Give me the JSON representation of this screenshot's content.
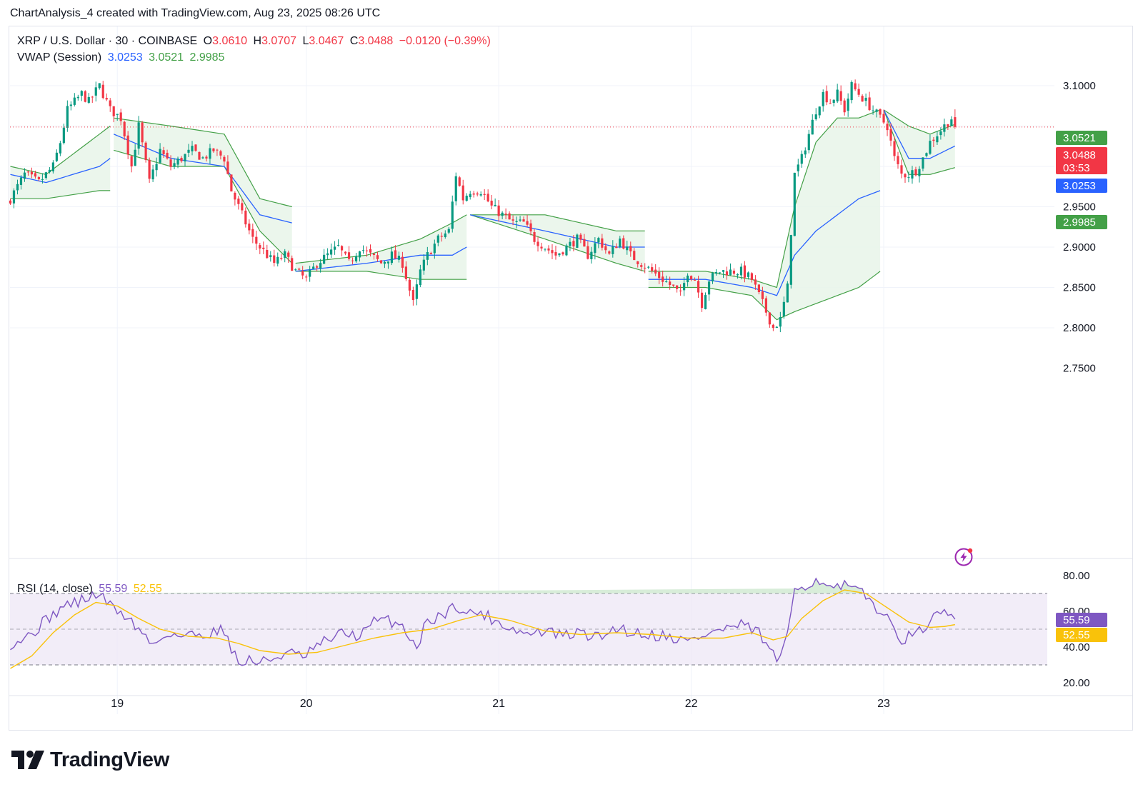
{
  "header": {
    "text": "ChartAnalysis_4 created with TradingView.com, Aug 23, 2025 08:26 UTC"
  },
  "legend": {
    "symbol": "XRP / U.S. Dollar · 30 · COINBASE",
    "o_label": "O",
    "o_value": "3.0610",
    "h_label": "H",
    "h_value": "3.0707",
    "l_label": "L",
    "l_value": "3.0467",
    "c_label": "C",
    "c_value": "3.0488",
    "change": "−0.0120 (−0.39%)",
    "vwap_label": "VWAP (Session)",
    "vwap_mid": "3.0253",
    "vwap_upper": "3.0521",
    "vwap_lower": "2.9985",
    "rsi_label": "RSI (14, close)",
    "rsi_value": "55.59",
    "rsi_ma": "52.55"
  },
  "colors": {
    "up": "#089981",
    "down": "#f23645",
    "vwap": "#2962ff",
    "band": "#43a047",
    "band_fill": "#e8f5e9",
    "rsi": "#7e57c2",
    "rsi_ma": "#f9c20a",
    "rsi_band": "#ede7f6"
  },
  "price_labels": [
    {
      "text": "3.0521",
      "color": "#43a047"
    },
    {
      "text": "3.0488",
      "sub": "03:53",
      "color": "#f23645"
    },
    {
      "text": "3.0253",
      "color": "#2962ff"
    },
    {
      "text": "2.9985",
      "color": "#43a047"
    }
  ],
  "rsi_labels": [
    {
      "text": "55.59",
      "color": "#7e57c2"
    },
    {
      "text": "52.55",
      "color": "#f9c20a"
    }
  ],
  "footer": {
    "brand": "TradingView"
  },
  "chart_data": {
    "type": "candlestick",
    "price_axis": {
      "ticks": [
        "3.1000",
        "2.9500",
        "2.9000",
        "2.8500",
        "2.8000",
        "2.7500"
      ],
      "range": [
        2.75,
        3.122
      ]
    },
    "time_axis": {
      "ticks": [
        "19",
        "20",
        "21",
        "22",
        "23"
      ]
    },
    "rsi_axis": {
      "ticks": [
        "80.00",
        "60.00",
        "40.00",
        "20.00"
      ],
      "range": [
        20,
        82
      ],
      "bands": [
        30,
        70
      ],
      "mid": 50
    },
    "anchors": [
      [
        0,
        2.96
      ],
      [
        4,
        2.99
      ],
      [
        8,
        2.98
      ],
      [
        12,
        3.0
      ],
      [
        14,
        3.03
      ],
      [
        16,
        3.07
      ],
      [
        20,
        3.09
      ],
      [
        22,
        3.08
      ],
      [
        25,
        3.1
      ],
      [
        28,
        3.07
      ],
      [
        31,
        3.06
      ],
      [
        34,
        3.0
      ],
      [
        36,
        3.05
      ],
      [
        39,
        2.98
      ],
      [
        42,
        3.02
      ],
      [
        45,
        3.0
      ],
      [
        48,
        3.01
      ],
      [
        51,
        3.02
      ],
      [
        54,
        3.01
      ],
      [
        57,
        3.02
      ],
      [
        60,
        3.01
      ],
      [
        62,
        2.97
      ],
      [
        64,
        2.95
      ],
      [
        66,
        2.93
      ],
      [
        68,
        2.91
      ],
      [
        70,
        2.9
      ],
      [
        72,
        2.89
      ],
      [
        74,
        2.88
      ],
      [
        77,
        2.89
      ],
      [
        80,
        2.87
      ],
      [
        83,
        2.86
      ],
      [
        86,
        2.88
      ],
      [
        89,
        2.89
      ],
      [
        92,
        2.9
      ],
      [
        95,
        2.88
      ],
      [
        98,
        2.9
      ],
      [
        101,
        2.89
      ],
      [
        104,
        2.88
      ],
      [
        107,
        2.89
      ],
      [
        110,
        2.88
      ],
      [
        113,
        2.83
      ],
      [
        115,
        2.87
      ],
      [
        117,
        2.89
      ],
      [
        120,
        2.91
      ],
      [
        123,
        2.92
      ],
      [
        125,
        2.99
      ],
      [
        127,
        2.96
      ],
      [
        129,
        2.97
      ],
      [
        132,
        2.97
      ],
      [
        135,
        2.95
      ],
      [
        138,
        2.94
      ],
      [
        141,
        2.93
      ],
      [
        144,
        2.93
      ],
      [
        147,
        2.91
      ],
      [
        150,
        2.9
      ],
      [
        153,
        2.89
      ],
      [
        156,
        2.9
      ],
      [
        159,
        2.91
      ],
      [
        162,
        2.89
      ],
      [
        165,
        2.91
      ],
      [
        168,
        2.89
      ],
      [
        171,
        2.91
      ],
      [
        174,
        2.89
      ],
      [
        177,
        2.88
      ],
      [
        180,
        2.87
      ],
      [
        183,
        2.86
      ],
      [
        186,
        2.85
      ],
      [
        188,
        2.84
      ],
      [
        190,
        2.87
      ],
      [
        192,
        2.86
      ],
      [
        194,
        2.83
      ],
      [
        196,
        2.86
      ],
      [
        199,
        2.87
      ],
      [
        202,
        2.87
      ],
      [
        205,
        2.87
      ],
      [
        208,
        2.86
      ],
      [
        210,
        2.84
      ],
      [
        212,
        2.82
      ],
      [
        214,
        2.8
      ],
      [
        216,
        2.81
      ],
      [
        218,
        2.85
      ],
      [
        220,
        2.99
      ],
      [
        222,
        3.01
      ],
      [
        224,
        3.04
      ],
      [
        226,
        3.07
      ],
      [
        228,
        3.09
      ],
      [
        230,
        3.08
      ],
      [
        232,
        3.09
      ],
      [
        234,
        3.07
      ],
      [
        236,
        3.1
      ],
      [
        238,
        3.09
      ],
      [
        240,
        3.08
      ],
      [
        242,
        3.07
      ],
      [
        244,
        3.06
      ],
      [
        246,
        3.05
      ],
      [
        248,
        3.01
      ],
      [
        250,
        2.99
      ],
      [
        252,
        2.99
      ],
      [
        254,
        2.995
      ],
      [
        256,
        3.01
      ],
      [
        258,
        3.03
      ],
      [
        260,
        3.04
      ],
      [
        262,
        3.05
      ],
      [
        264,
        3.06
      ],
      [
        265,
        3.0488
      ]
    ],
    "vwap_sessions": [
      {
        "upper": [
          [
            0,
            3.0
          ],
          [
            10,
            2.99
          ],
          [
            25,
            3.04
          ],
          [
            28,
            3.05
          ]
        ],
        "vwap": [
          [
            0,
            2.99
          ],
          [
            10,
            2.98
          ],
          [
            25,
            3.0
          ],
          [
            28,
            3.01
          ]
        ],
        "lower": [
          [
            0,
            2.96
          ],
          [
            10,
            2.96
          ],
          [
            25,
            2.97
          ],
          [
            28,
            2.97
          ]
        ]
      },
      {
        "upper": [
          [
            29,
            3.06
          ],
          [
            45,
            3.05
          ],
          [
            60,
            3.04
          ],
          [
            70,
            2.96
          ],
          [
            79,
            2.95
          ]
        ],
        "vwap": [
          [
            29,
            3.04
          ],
          [
            45,
            3.01
          ],
          [
            60,
            3.0
          ],
          [
            70,
            2.94
          ],
          [
            79,
            2.93
          ]
        ],
        "lower": [
          [
            29,
            3.02
          ],
          [
            45,
            3.0
          ],
          [
            60,
            3.0
          ],
          [
            70,
            2.92
          ],
          [
            79,
            2.88
          ]
        ]
      },
      {
        "upper": [
          [
            80,
            2.88
          ],
          [
            100,
            2.89
          ],
          [
            115,
            2.91
          ],
          [
            124,
            2.93
          ],
          [
            128,
            2.94
          ]
        ],
        "vwap": [
          [
            80,
            2.87
          ],
          [
            100,
            2.88
          ],
          [
            115,
            2.89
          ],
          [
            124,
            2.89
          ],
          [
            128,
            2.9
          ]
        ],
        "lower": [
          [
            80,
            2.87
          ],
          [
            100,
            2.87
          ],
          [
            115,
            2.86
          ],
          [
            128,
            2.86
          ]
        ]
      },
      {
        "upper": [
          [
            129,
            2.94
          ],
          [
            150,
            2.94
          ],
          [
            170,
            2.92
          ],
          [
            178,
            2.92
          ]
        ],
        "vwap": [
          [
            129,
            2.94
          ],
          [
            150,
            2.92
          ],
          [
            170,
            2.9
          ],
          [
            178,
            2.9
          ]
        ],
        "lower": [
          [
            129,
            2.94
          ],
          [
            150,
            2.91
          ],
          [
            170,
            2.88
          ],
          [
            178,
            2.87
          ]
        ]
      },
      {
        "upper": [
          [
            179,
            2.87
          ],
          [
            195,
            2.87
          ],
          [
            208,
            2.86
          ],
          [
            215,
            2.85
          ],
          [
            220,
            2.95
          ],
          [
            226,
            3.03
          ],
          [
            232,
            3.06
          ],
          [
            238,
            3.06
          ],
          [
            244,
            3.07
          ]
        ],
        "vwap": [
          [
            179,
            2.86
          ],
          [
            195,
            2.86
          ],
          [
            208,
            2.85
          ],
          [
            215,
            2.84
          ],
          [
            220,
            2.89
          ],
          [
            226,
            2.92
          ],
          [
            232,
            2.94
          ],
          [
            238,
            2.96
          ],
          [
            244,
            2.97
          ]
        ],
        "lower": [
          [
            179,
            2.85
          ],
          [
            195,
            2.85
          ],
          [
            208,
            2.84
          ],
          [
            215,
            2.81
          ],
          [
            220,
            2.82
          ],
          [
            226,
            2.83
          ],
          [
            232,
            2.84
          ],
          [
            238,
            2.85
          ],
          [
            244,
            2.87
          ]
        ]
      },
      {
        "upper": [
          [
            245,
            3.07
          ],
          [
            252,
            3.05
          ],
          [
            258,
            3.04
          ],
          [
            265,
            3.0521
          ]
        ],
        "vwap": [
          [
            245,
            3.07
          ],
          [
            252,
            3.01
          ],
          [
            258,
            3.01
          ],
          [
            265,
            3.0253
          ]
        ],
        "lower": [
          [
            245,
            3.07
          ],
          [
            252,
            2.99
          ],
          [
            258,
            2.99
          ],
          [
            265,
            2.9985
          ]
        ]
      }
    ],
    "rsi_anchors": [
      [
        0,
        42
      ],
      [
        5,
        46
      ],
      [
        10,
        55
      ],
      [
        15,
        63
      ],
      [
        20,
        66
      ],
      [
        25,
        70
      ],
      [
        28,
        63
      ],
      [
        32,
        58
      ],
      [
        36,
        50
      ],
      [
        40,
        41
      ],
      [
        44,
        48
      ],
      [
        48,
        46
      ],
      [
        52,
        47
      ],
      [
        56,
        48
      ],
      [
        60,
        50
      ],
      [
        62,
        40
      ],
      [
        64,
        30
      ],
      [
        67,
        33
      ],
      [
        70,
        31
      ],
      [
        74,
        34
      ],
      [
        78,
        37
      ],
      [
        82,
        34
      ],
      [
        86,
        40
      ],
      [
        90,
        45
      ],
      [
        94,
        48
      ],
      [
        98,
        46
      ],
      [
        102,
        54
      ],
      [
        106,
        55
      ],
      [
        110,
        52
      ],
      [
        114,
        40
      ],
      [
        117,
        55
      ],
      [
        120,
        57
      ],
      [
        123,
        60
      ],
      [
        125,
        64
      ],
      [
        128,
        58
      ],
      [
        131,
        60
      ],
      [
        135,
        56
      ],
      [
        140,
        51
      ],
      [
        145,
        47
      ],
      [
        150,
        49
      ],
      [
        155,
        46
      ],
      [
        160,
        48
      ],
      [
        165,
        45
      ],
      [
        170,
        51
      ],
      [
        175,
        48
      ],
      [
        180,
        47
      ],
      [
        185,
        46
      ],
      [
        190,
        43
      ],
      [
        195,
        47
      ],
      [
        200,
        50
      ],
      [
        205,
        52
      ],
      [
        210,
        48
      ],
      [
        214,
        35
      ],
      [
        216,
        33
      ],
      [
        218,
        45
      ],
      [
        220,
        73
      ],
      [
        224,
        76
      ],
      [
        228,
        78
      ],
      [
        230,
        72
      ],
      [
        234,
        74
      ],
      [
        238,
        71
      ],
      [
        242,
        65
      ],
      [
        246,
        55
      ],
      [
        250,
        45
      ],
      [
        254,
        46
      ],
      [
        258,
        55
      ],
      [
        262,
        58
      ],
      [
        264,
        57
      ],
      [
        265,
        55.59
      ]
    ],
    "rsi_ma_anchors": [
      [
        0,
        28
      ],
      [
        6,
        35
      ],
      [
        12,
        48
      ],
      [
        18,
        58
      ],
      [
        24,
        65
      ],
      [
        30,
        63
      ],
      [
        36,
        56
      ],
      [
        42,
        50
      ],
      [
        50,
        46
      ],
      [
        58,
        45
      ],
      [
        64,
        42
      ],
      [
        70,
        38
      ],
      [
        78,
        36
      ],
      [
        86,
        37
      ],
      [
        94,
        41
      ],
      [
        102,
        45
      ],
      [
        110,
        48
      ],
      [
        118,
        50
      ],
      [
        126,
        55
      ],
      [
        132,
        58
      ],
      [
        140,
        55
      ],
      [
        150,
        49
      ],
      [
        160,
        47
      ],
      [
        170,
        48
      ],
      [
        180,
        47
      ],
      [
        190,
        45
      ],
      [
        200,
        45
      ],
      [
        208,
        48
      ],
      [
        214,
        44
      ],
      [
        218,
        46
      ],
      [
        222,
        56
      ],
      [
        228,
        66
      ],
      [
        234,
        72
      ],
      [
        240,
        70
      ],
      [
        246,
        62
      ],
      [
        252,
        54
      ],
      [
        258,
        51
      ],
      [
        262,
        51.5
      ],
      [
        265,
        52.55
      ]
    ]
  }
}
